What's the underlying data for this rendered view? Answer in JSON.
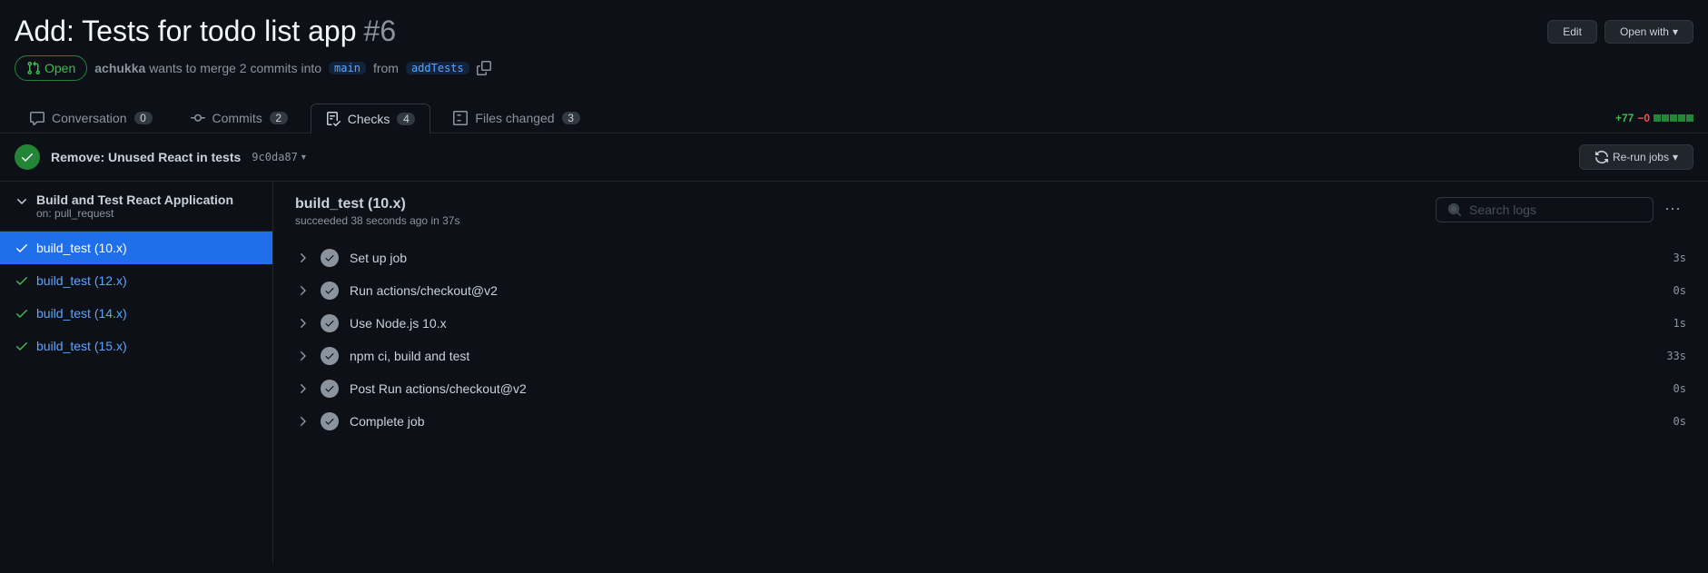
{
  "header": {
    "title": "Add: Tests for todo list app",
    "number": "#6",
    "edit_label": "Edit",
    "open_with_label": "Open with"
  },
  "meta": {
    "state": "Open",
    "author": "achukka",
    "merge_text_1": "wants to merge 2 commits into",
    "base_branch": "main",
    "merge_text_2": "from",
    "head_branch": "addTests"
  },
  "tabs": {
    "conversation": {
      "label": "Conversation",
      "count": "0"
    },
    "commits": {
      "label": "Commits",
      "count": "2"
    },
    "checks": {
      "label": "Checks",
      "count": "4"
    },
    "files": {
      "label": "Files changed",
      "count": "3"
    }
  },
  "diff": {
    "additions": "+77",
    "deletions": "−0"
  },
  "commit_bar": {
    "title": "Remove: Unused React in tests",
    "sha": "9c0da87",
    "rerun_label": "Re-run jobs"
  },
  "sidebar": {
    "workflow_name": "Build and Test React Application",
    "event": "on: pull_request",
    "jobs": [
      {
        "label": "build_test (10.x)",
        "selected": true
      },
      {
        "label": "build_test (12.x)",
        "selected": false
      },
      {
        "label": "build_test (14.x)",
        "selected": false
      },
      {
        "label": "build_test (15.x)",
        "selected": false
      }
    ]
  },
  "content": {
    "job_title": "build_test (10.x)",
    "job_subtitle": "succeeded 38 seconds ago in 37s",
    "search_placeholder": "Search logs",
    "steps": [
      {
        "name": "Set up job",
        "duration": "3s"
      },
      {
        "name": "Run actions/checkout@v2",
        "duration": "0s"
      },
      {
        "name": "Use Node.js 10.x",
        "duration": "1s"
      },
      {
        "name": "npm ci, build and test",
        "duration": "33s"
      },
      {
        "name": "Post Run actions/checkout@v2",
        "duration": "0s"
      },
      {
        "name": "Complete job",
        "duration": "0s"
      }
    ]
  }
}
